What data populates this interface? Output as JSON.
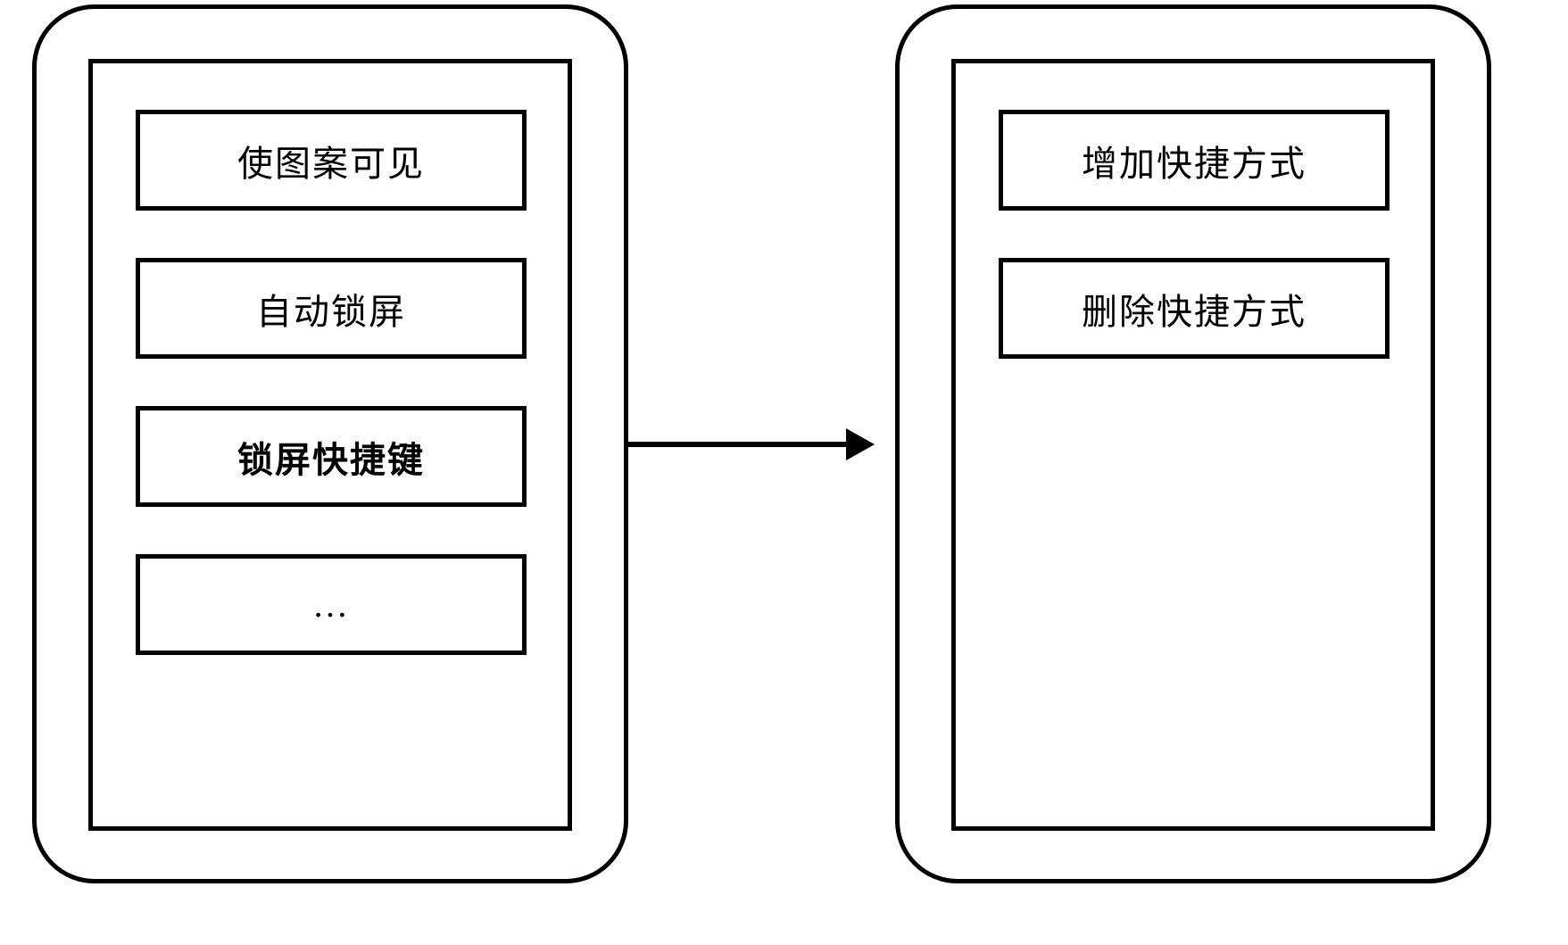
{
  "left_device": {
    "options": [
      {
        "label": "使图案可见",
        "bold": false
      },
      {
        "label": "自动锁屏",
        "bold": false
      },
      {
        "label": "锁屏快捷键",
        "bold": true
      },
      {
        "label": "…",
        "bold": false
      }
    ]
  },
  "right_device": {
    "options": [
      {
        "label": "增加快捷方式",
        "bold": false
      },
      {
        "label": "删除快捷方式",
        "bold": false
      }
    ]
  }
}
